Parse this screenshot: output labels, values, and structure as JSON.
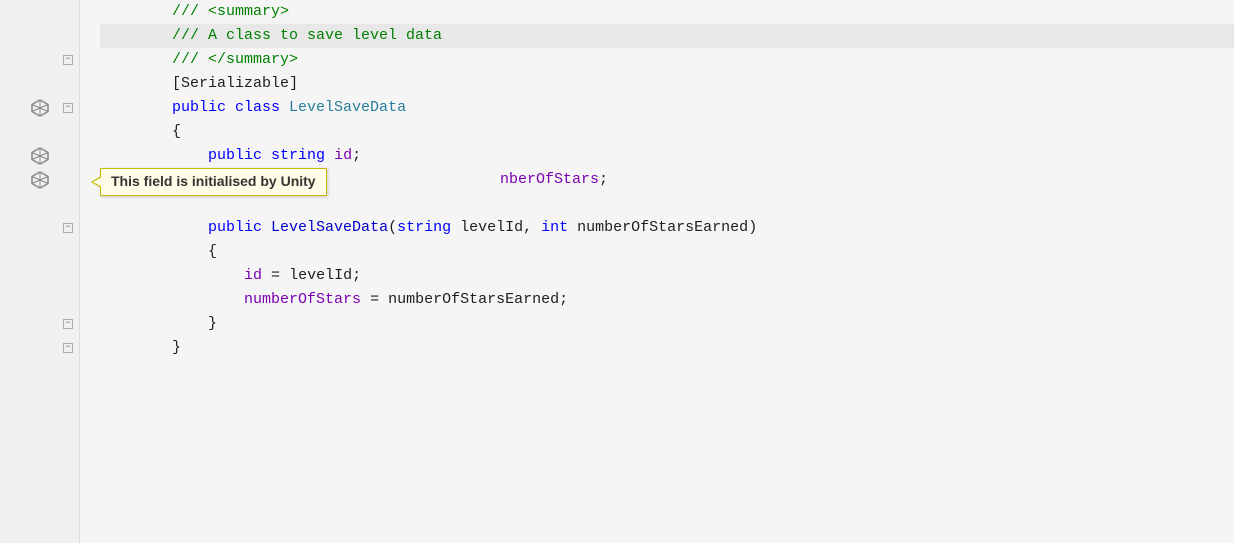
{
  "editor": {
    "background": "#f5f5f5",
    "lines": [
      {
        "id": 1,
        "indent": "        ",
        "tokens": [
          {
            "text": "/// ",
            "class": "c-comment"
          },
          {
            "text": "<summary>",
            "class": "c-comment"
          }
        ],
        "gutter": {
          "unity": false,
          "fold": false
        },
        "highlighted": false
      },
      {
        "id": 2,
        "indent": "        ",
        "tokens": [
          {
            "text": "/// A class to save level data",
            "class": "c-comment"
          }
        ],
        "gutter": {
          "unity": false,
          "fold": false
        },
        "highlighted": true
      },
      {
        "id": 3,
        "indent": "        ",
        "tokens": [
          {
            "text": "/// ",
            "class": "c-comment"
          },
          {
            "text": "</summary>",
            "class": "c-comment"
          }
        ],
        "gutter": {
          "unity": false,
          "fold": "minus"
        },
        "highlighted": false
      },
      {
        "id": 4,
        "indent": "        ",
        "tokens": [
          {
            "text": "[",
            "class": "c-plain"
          },
          {
            "text": "Serializable",
            "class": "c-plain"
          },
          {
            "text": "]",
            "class": "c-plain"
          }
        ],
        "gutter": {
          "unity": false,
          "fold": false
        },
        "highlighted": false
      },
      {
        "id": 5,
        "indent": "        ",
        "tokens": [
          {
            "text": "public ",
            "class": "c-keyword"
          },
          {
            "text": "class ",
            "class": "c-keyword"
          },
          {
            "text": "LevelSaveData",
            "class": "c-class-name"
          }
        ],
        "gutter": {
          "unity": "icon",
          "fold": "minus"
        },
        "highlighted": false
      },
      {
        "id": 6,
        "indent": "        ",
        "tokens": [
          {
            "text": "{",
            "class": "c-plain"
          }
        ],
        "gutter": {
          "unity": false,
          "fold": false
        },
        "highlighted": false
      },
      {
        "id": 7,
        "indent": "            ",
        "tokens": [
          {
            "text": "public ",
            "class": "c-keyword"
          },
          {
            "text": "string ",
            "class": "c-keyword"
          },
          {
            "text": "id",
            "class": "c-purple"
          },
          {
            "text": ";",
            "class": "c-plain"
          }
        ],
        "gutter": {
          "unity": "icon",
          "fold": false
        },
        "highlighted": false
      },
      {
        "id": 8,
        "indent": "            ",
        "tokens": [
          {
            "text": "nberOfStars",
            "class": "c-purple"
          },
          {
            "text": ";",
            "class": "c-plain"
          }
        ],
        "gutter": {
          "unity": "icon",
          "fold": false
        },
        "highlighted": false,
        "tooltip": true
      },
      {
        "id": 9,
        "indent": "        ",
        "tokens": [],
        "gutter": {
          "unity": false,
          "fold": false
        },
        "highlighted": false
      },
      {
        "id": 10,
        "indent": "            ",
        "tokens": [
          {
            "text": "public ",
            "class": "c-keyword"
          },
          {
            "text": "LevelSaveData",
            "class": "c-blue"
          },
          {
            "text": "(",
            "class": "c-plain"
          },
          {
            "text": "string ",
            "class": "c-keyword"
          },
          {
            "text": "levelId",
            "class": "c-plain"
          },
          {
            "text": ", ",
            "class": "c-plain"
          },
          {
            "text": "int ",
            "class": "c-keyword"
          },
          {
            "text": "numberOfStarsEarned",
            "class": "c-plain"
          },
          {
            "text": ")",
            "class": "c-plain"
          }
        ],
        "gutter": {
          "unity": false,
          "fold": "minus"
        },
        "highlighted": false
      },
      {
        "id": 11,
        "indent": "            ",
        "tokens": [
          {
            "text": "{",
            "class": "c-plain"
          }
        ],
        "gutter": {
          "unity": false,
          "fold": false
        },
        "highlighted": false
      },
      {
        "id": 12,
        "indent": "                ",
        "tokens": [
          {
            "text": "id",
            "class": "c-purple"
          },
          {
            "text": " = ",
            "class": "c-plain"
          },
          {
            "text": "levelId",
            "class": "c-plain"
          },
          {
            "text": ";",
            "class": "c-plain"
          }
        ],
        "gutter": {
          "unity": false,
          "fold": false
        },
        "highlighted": false
      },
      {
        "id": 13,
        "indent": "                ",
        "tokens": [
          {
            "text": "numberOfStars",
            "class": "c-purple"
          },
          {
            "text": " = ",
            "class": "c-plain"
          },
          {
            "text": "numberOfStarsEarned",
            "class": "c-plain"
          },
          {
            "text": ";",
            "class": "c-plain"
          }
        ],
        "gutter": {
          "unity": false,
          "fold": false
        },
        "highlighted": false
      },
      {
        "id": 14,
        "indent": "            ",
        "tokens": [
          {
            "text": "}",
            "class": "c-plain"
          }
        ],
        "gutter": {
          "unity": false,
          "fold": "minus"
        },
        "highlighted": false
      },
      {
        "id": 15,
        "indent": "        ",
        "tokens": [
          {
            "text": "}",
            "class": "c-plain"
          }
        ],
        "gutter": {
          "unity": false,
          "fold": "minus"
        },
        "highlighted": false
      }
    ],
    "tooltip": {
      "text": "This field is initialised by Unity",
      "line": 8
    }
  }
}
